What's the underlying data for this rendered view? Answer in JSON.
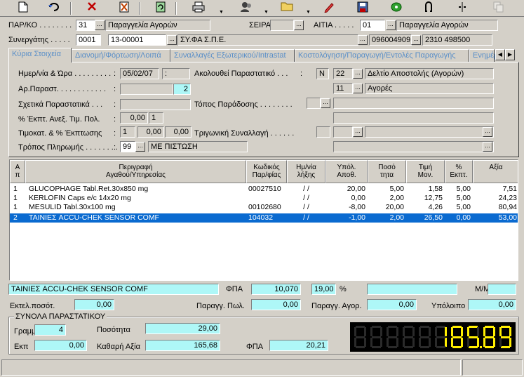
{
  "header": {
    "parko_label": "ΠΑΡ/ΚΟ . . . . . . . .",
    "parko_code": "31",
    "parko_name": "Παραγγελία Αγορών",
    "seira_label": "ΣΕΙΡΑ . . .",
    "seira_value": "",
    "aitia_label": "ΑΙΤΙΑ . . . . .",
    "aitia_code": "01",
    "aitia_name": "Παραγγελία Αγορών",
    "partner_label": "Συνεργάτης . . . . .",
    "partner_branch": "0001",
    "partner_code": "13-00001",
    "partner_name": "ΣΥ.ΦΑ Σ.Π.Ε.",
    "partner_afm": "096004909",
    "partner_phone": "2310 498500"
  },
  "tabs": [
    {
      "label": "Κύρια Στοιχεία"
    },
    {
      "label": "Διανομή/Φόρτωση/Λοιπά"
    },
    {
      "label": "Συναλλαγές Εξωτερικού/Intrastat"
    },
    {
      "label": "Κοστολόγηση/Παραγωγή/Εντολές Παραγωγής"
    },
    {
      "label": "Ενημέρ"
    }
  ],
  "main": {
    "date_label": "Ημερ/νία & Ώρα . . . . . . . . .",
    "date_value": "05/02/07",
    "time_value": ":",
    "arparast_label": "Αρ.Παραστ. . . . . . . . . . . .",
    "arparast_value": "",
    "arparast_num": "2",
    "sxetika_label": "Σχετικά Παραστατικά . . .",
    "ekpt_label": "% Έκπτ. Ανεξ. Τιμ. Πολ.",
    "ekpt_value": "0,00",
    "ekpt_value2": "1",
    "timokat_label": "Τιμοκατ. & % Έκπτωσης",
    "timokat_value": "1",
    "timokat_pct1": "0,00",
    "timokat_pct2": "0,00",
    "payment_label": "Τρόπος Πληρωμής . . . . . . . .",
    "payment_code": "99",
    "payment_name": "ΜΕ ΠΙΣΤΩΣΗ",
    "follows_label": "Ακολουθεί Παραστατικό . . .",
    "follows_flag": "N",
    "follows_code": "22",
    "follows_name": "Δελτίο Αποστολής         (Αγορών)",
    "follows_code2": "11",
    "follows_name2": "Αγορές",
    "topos_label": "Τόπος Παράδοσης . . . . . . . .",
    "trigoniki_label": "Τριγωνική Συναλλαγή . . . . . ."
  },
  "grid": {
    "columns": [
      "Α\nπ",
      "Περιγραφή\nΑγαθού/Υπηρεσίας",
      "Κωδικός\nΠαρ/φίας",
      "Ημ/νία\nλήξης",
      "Υπόλ.\nΑποθ.",
      "Ποσό\nτητα",
      "Τιμή\nΜον.",
      "%\nΕκπτ.",
      "Αξία"
    ],
    "rows": [
      {
        "ap": "1",
        "desc": "GLUCOPHAGE Tabl.Ret.30x850 mg",
        "code": "00027510",
        "date": "/ /",
        "stock": "20,00",
        "qty": "5,00",
        "price": "1,58",
        "disc": "5,00",
        "value": "7,51"
      },
      {
        "ap": "1",
        "desc": "KERLOFIN Caps e/c 14x20 mg",
        "code": "",
        "date": "/ /",
        "stock": "0,00",
        "qty": "2,00",
        "price": "12,75",
        "disc": "5,00",
        "value": "24,23"
      },
      {
        "ap": "1",
        "desc": "MESULID  Tabl.30x100 mg",
        "code": "00102680",
        "date": "/ /",
        "stock": "-8,00",
        "qty": "20,00",
        "price": "4,26",
        "disc": "5,00",
        "value": "80,94"
      },
      {
        "ap": "2",
        "desc": "ΤΑΙΝΙΕΣ ACCU-CHEK SENSOR COMF",
        "code": "104032",
        "date": "/ /",
        "stock": "-1,00",
        "qty": "2,00",
        "price": "26,50",
        "disc": "0,00",
        "value": "53,00"
      }
    ]
  },
  "details": {
    "item_name": "ΤΑΙΝΙΕΣ ACCU-CHEK SENSOR COMF",
    "fpa_label": "ΦΠΑ",
    "fpa_code": "10,070",
    "fpa_rate": "19,00",
    "pct": "%",
    "mm_label": "Μ/Μ",
    "ektel_label": "Εκτελ.ποσότ.",
    "ektel_value": "0,00",
    "parag_pol_label": "Παραγγ. Πωλ.",
    "parag_pol_value": "0,00",
    "parag_agor_label": "Παραγγ. Αγορ.",
    "parag_agor_value": "0,00",
    "ypoloipo_label": "Υπόλοιπο",
    "ypoloipo_value": "0,00"
  },
  "totals": {
    "group_label": "ΣΥΝΟΛΑ ΠΑΡΑΣΤΑΤΙΚΟΥ",
    "lines_label": "Γραμμές",
    "lines_value": "4",
    "qty_label": "Ποσότητα",
    "qty_value": "29,00",
    "ekp_label": "Εκπ",
    "ekp_value": "0,00",
    "net_label": "Καθαρή Αξία",
    "net_value": "165,68",
    "fpa_label": "ΦΠΑ",
    "fpa_value": "20,21",
    "display_value": "185.89"
  },
  "colors": {
    "window": "#d4d0c8",
    "field_cyan": "#aef7f7",
    "selection": "#0a6ad0",
    "tab_text": "#5a8fc8",
    "led_digit": "#ffee00"
  }
}
